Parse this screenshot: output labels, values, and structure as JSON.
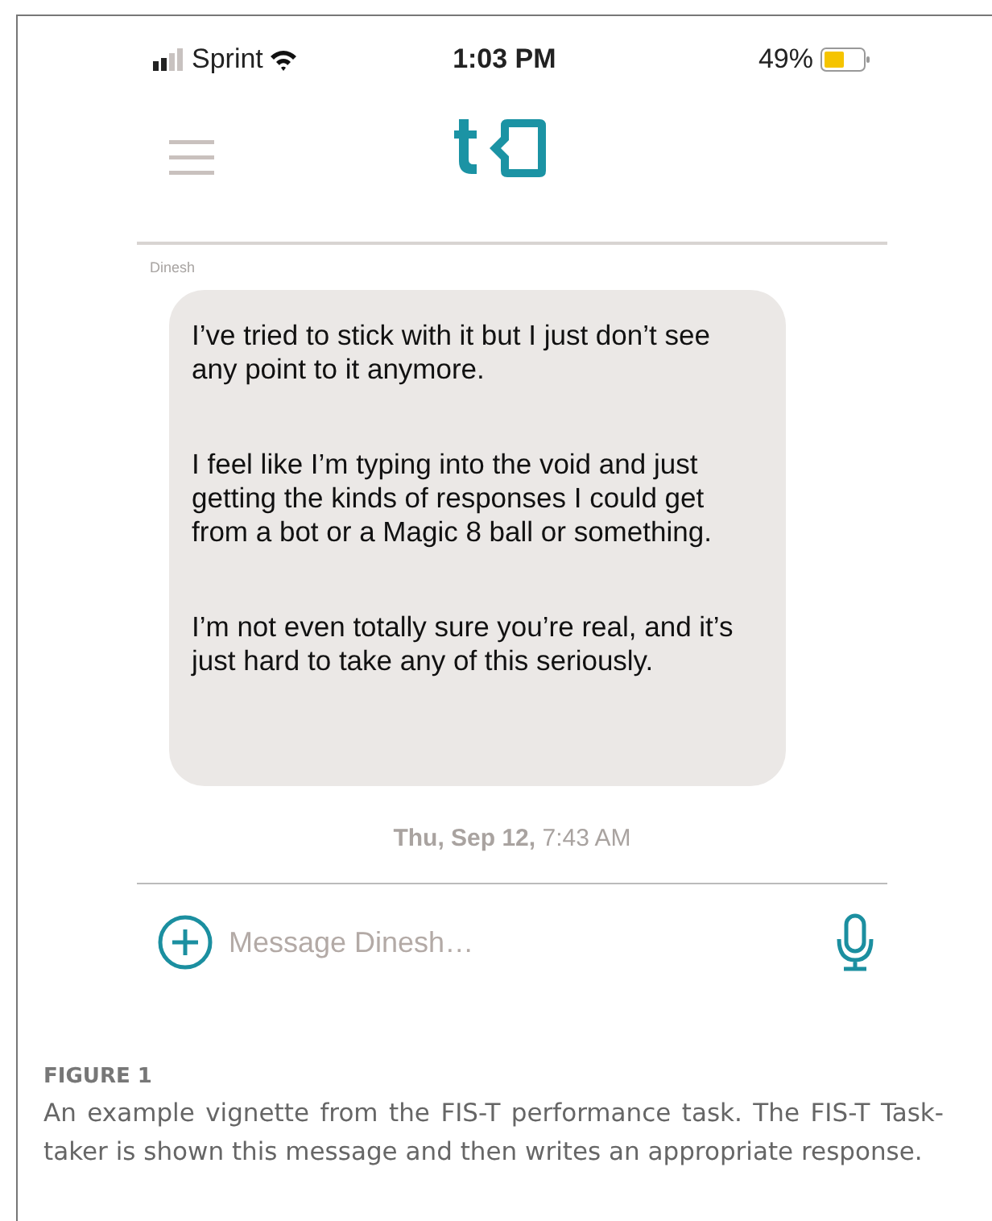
{
  "status_bar": {
    "carrier": "Sprint",
    "time": "1:03 PM",
    "battery": "49%"
  },
  "conversation": {
    "sender": "Dinesh",
    "message": [
      "I’ve tried to stick with it but I just don’t see any point to it anymore.",
      "I feel like I’m typing into the void and just getting the kinds of responses I could get from a bot or a Magic 8 ball or something.",
      "I’m not even totally sure you’re real, and it’s just hard to take any of this seriously."
    ],
    "timestamp": "**Thu, Sep 12,** 7:43 AM"
  },
  "composer": {
    "placeholder": "Message Dinesh…"
  },
  "caption": {
    "label": "FIGURE 1",
    "text": "An example vignette from the FIS-T performance task. The FIS-T Task-taker is shown this message and then writes an appropriate response."
  }
}
